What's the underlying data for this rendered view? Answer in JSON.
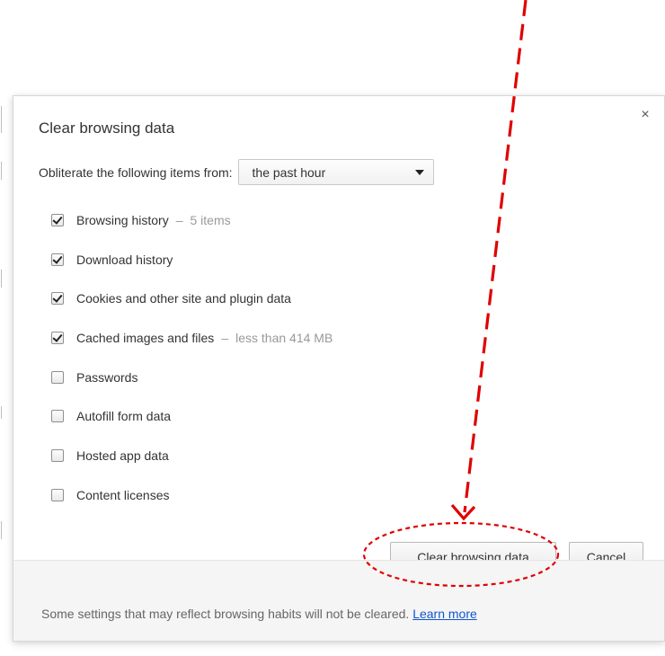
{
  "dialog": {
    "title": "Clear browsing data",
    "close_glyph": "×",
    "from_label": "Obliterate the following items from:",
    "time_range": {
      "selected": "the past hour"
    },
    "items": [
      {
        "label": "Browsing history",
        "checked": true,
        "detail": "5 items"
      },
      {
        "label": "Download history",
        "checked": true,
        "detail": ""
      },
      {
        "label": "Cookies and other site and plugin data",
        "checked": true,
        "detail": ""
      },
      {
        "label": "Cached images and files",
        "checked": true,
        "detail": "less than 414 MB"
      },
      {
        "label": "Passwords",
        "checked": false,
        "detail": ""
      },
      {
        "label": "Autofill form data",
        "checked": false,
        "detail": ""
      },
      {
        "label": "Hosted app data",
        "checked": false,
        "detail": ""
      },
      {
        "label": "Content licenses",
        "checked": false,
        "detail": ""
      }
    ],
    "buttons": {
      "clear": "Clear browsing data",
      "cancel": "Cancel"
    },
    "footer": {
      "text": "Some settings that may reflect browsing habits will not be cleared.",
      "link": "Learn more"
    }
  },
  "annotation": {
    "color": "#e00000"
  }
}
